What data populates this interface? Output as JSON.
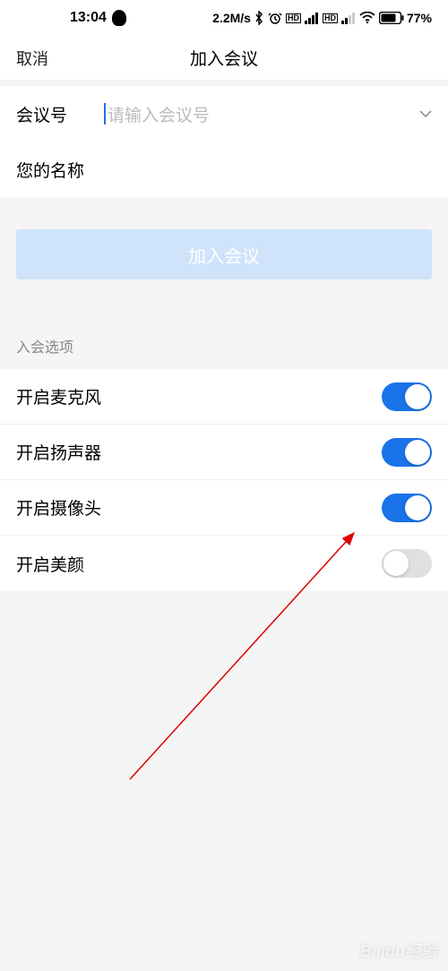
{
  "status": {
    "time": "13:04",
    "speed": "2.2M/s",
    "battery": "77%"
  },
  "nav": {
    "cancel": "取消",
    "title": "加入会议"
  },
  "fields": {
    "meeting_id_label": "会议号",
    "meeting_id_placeholder": "请输入会议号",
    "name_label": "您的名称",
    "name_value": ""
  },
  "join_button": "加入会议",
  "options": {
    "section_title": "入会选项",
    "items": [
      {
        "label": "开启麦克风",
        "on": true
      },
      {
        "label": "开启扬声器",
        "on": true
      },
      {
        "label": "开启摄像头",
        "on": true
      },
      {
        "label": "开启美颜",
        "on": false
      }
    ]
  },
  "watermark": "Baidu经验"
}
